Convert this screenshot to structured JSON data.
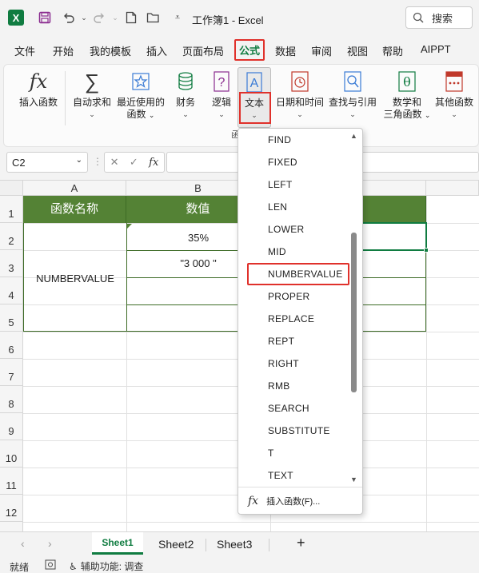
{
  "titlebar": {
    "excel_icon": "X",
    "title": "工作簿1 - Excel",
    "search": "搜索"
  },
  "menu": {
    "tabs": [
      "文件",
      "开始",
      "我的模板",
      "插入",
      "页面布局",
      "公式",
      "数据",
      "审阅",
      "视图",
      "帮助",
      "AIPPT"
    ]
  },
  "ribbon": {
    "insert_function": "插入函数",
    "autosum": "自动求和",
    "recent_1": "最近使用的",
    "recent_2": "函数",
    "financial": "财务",
    "logical": "逻辑",
    "text": "文本",
    "datetime": "日期和时间",
    "lookup": "查找与引用",
    "math_1": "数学和",
    "math_2": "三角函数",
    "other": "其他函数",
    "group_label": "函"
  },
  "formula_bar": {
    "name_box": "C2",
    "fx": "fx"
  },
  "grid": {
    "columns": [
      "A",
      "B"
    ],
    "rows": [
      "1",
      "2",
      "3",
      "4",
      "5",
      "6",
      "7",
      "8",
      "9",
      "10",
      "11",
      "12"
    ],
    "header_a": "函数名称",
    "header_b": "数值",
    "a2": "NUMBERVALUE",
    "b2": "35%",
    "b3": "\"3 000 \""
  },
  "dropdown": {
    "items": [
      "FIND",
      "FIXED",
      "LEFT",
      "LEN",
      "LOWER",
      "MID",
      "NUMBERVALUE",
      "PROPER",
      "REPLACE",
      "REPT",
      "RIGHT",
      "RMB",
      "SEARCH",
      "SUBSTITUTE",
      "T",
      "TEXT"
    ],
    "insert_function": "插入函数(F)..."
  },
  "sheets": {
    "tabs": [
      "Sheet1",
      "Sheet2",
      "Sheet3"
    ],
    "add": "+"
  },
  "status": {
    "ready": "就绪",
    "accessibility": "辅助功能: 调查"
  },
  "colors": {
    "excel_green": "#107c41",
    "header_green": "#548235",
    "highlight_red": "#e0312b"
  }
}
